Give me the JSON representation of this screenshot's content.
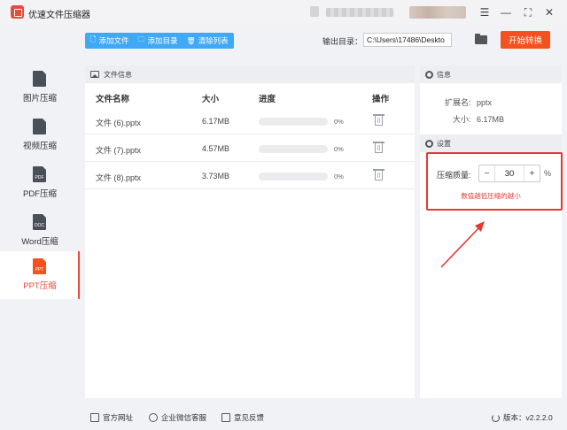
{
  "window": {
    "title": "优速文件压缩器",
    "menu_icon": "menu-icon",
    "minimize_icon": "minimize-icon",
    "maximize_icon": "maximize-icon",
    "close_icon": "close-icon"
  },
  "toolbar": {
    "add_file": "添加文件",
    "add_dir": "添加目录",
    "clear_list": "清除列表",
    "output_label": "输出目录：",
    "output_path": "C:\\Users\\17486\\Deskto",
    "convert": "开始转换"
  },
  "sidebar": {
    "items": [
      {
        "label": "图片压缩",
        "icon_text": ""
      },
      {
        "label": "视频压缩",
        "icon_text": ""
      },
      {
        "label": "PDF压缩",
        "icon_text": "PDF"
      },
      {
        "label": "Word压缩",
        "icon_text": "DOC"
      },
      {
        "label": "PPT压缩",
        "icon_text": "PPT"
      }
    ],
    "active_index": 4
  },
  "file_panel": {
    "header": "文件信息",
    "columns": {
      "name": "文件名称",
      "size": "大小",
      "progress": "进度",
      "action": "操作"
    },
    "rows": [
      {
        "name": "文件 (6).pptx",
        "size": "6.17MB",
        "progress_label": "0%",
        "progress": 0
      },
      {
        "name": "文件 (7).pptx",
        "size": "4.57MB",
        "progress_label": "0%",
        "progress": 0
      },
      {
        "name": "文件 (8).pptx",
        "size": "3.73MB",
        "progress_label": "0%",
        "progress": 0
      }
    ]
  },
  "info_panel": {
    "header": "信息",
    "ext_label": "扩展名:",
    "ext_value": "pptx",
    "size_label": "大小:",
    "size_value": "6.17MB"
  },
  "settings": {
    "header": "设置",
    "quality_label": "压缩质量:",
    "quality_value": "30",
    "unit": "%",
    "hint": "数值越低压缩的越小",
    "minus": "−",
    "plus": "+",
    "highlight_color": "#e53935"
  },
  "footer": {
    "website": "官方网址",
    "wechat": "企业微信客服",
    "feedback": "意见反馈",
    "version": "版本：v2.2.2.0"
  },
  "colors": {
    "accent_blue": "#3fa9f5",
    "accent_orange": "#f4511e",
    "active_red": "#e84a3b"
  }
}
